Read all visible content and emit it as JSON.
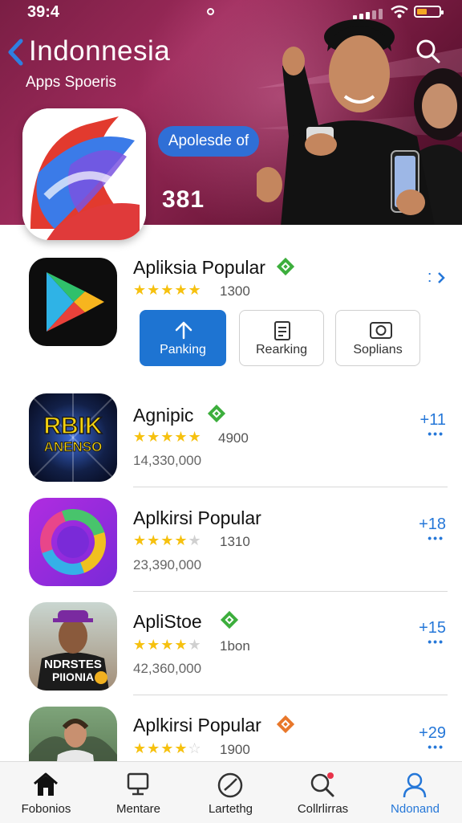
{
  "status_bar": {
    "time": "39:4"
  },
  "header": {
    "title": "Indonnesia",
    "subtitle": "Apps Spoeris",
    "pill_label": "Apolesde of",
    "count": "381"
  },
  "featured_row": {
    "name": "Apliksia Popular",
    "rating": "1300",
    "stars": 5,
    "more": ":",
    "chips": [
      {
        "label": "Panking",
        "icon": "upload-arrow-icon"
      },
      {
        "label": "Rearking",
        "icon": "document-icon"
      },
      {
        "label": "Soplians",
        "icon": "camera-icon"
      }
    ]
  },
  "apps": [
    {
      "name": "Agnipic",
      "rating": "4900",
      "downloads": "14,330,000",
      "plus": "+11",
      "stars": 5,
      "badge_color": "#3cae3c",
      "icon_text": [
        "RBIK",
        "ANENSO"
      ]
    },
    {
      "name": "Aplkirsi Popular",
      "rating": "1310",
      "downloads": "23,390,000",
      "plus": "+18",
      "stars": 4.5,
      "badge_color": "",
      "icon_text": []
    },
    {
      "name": "ApliStoe",
      "rating": "1bon",
      "downloads": "42,360,000",
      "plus": "+15",
      "stars": 4,
      "badge_color": "#3cae3c",
      "icon_text": [
        "NDRSTES",
        "PIIONIA"
      ]
    },
    {
      "name": "Aplkirsi  Popular",
      "rating": "1900",
      "downloads": "",
      "plus": "+29",
      "stars": 4.5,
      "badge_color": "#e8772a",
      "icon_text": []
    }
  ],
  "tabs": [
    {
      "label": "Fobonios",
      "icon": "home-icon"
    },
    {
      "label": "Mentare",
      "icon": "monitor-icon"
    },
    {
      "label": "Lartethg",
      "icon": "gauge-icon"
    },
    {
      "label": "Collrlirras",
      "icon": "search-icon"
    },
    {
      "label": "Ndonand",
      "icon": "profile-icon"
    }
  ],
  "colors": {
    "accent": "#2577d8",
    "hero": "#8a2350",
    "star": "#f6c10f"
  }
}
